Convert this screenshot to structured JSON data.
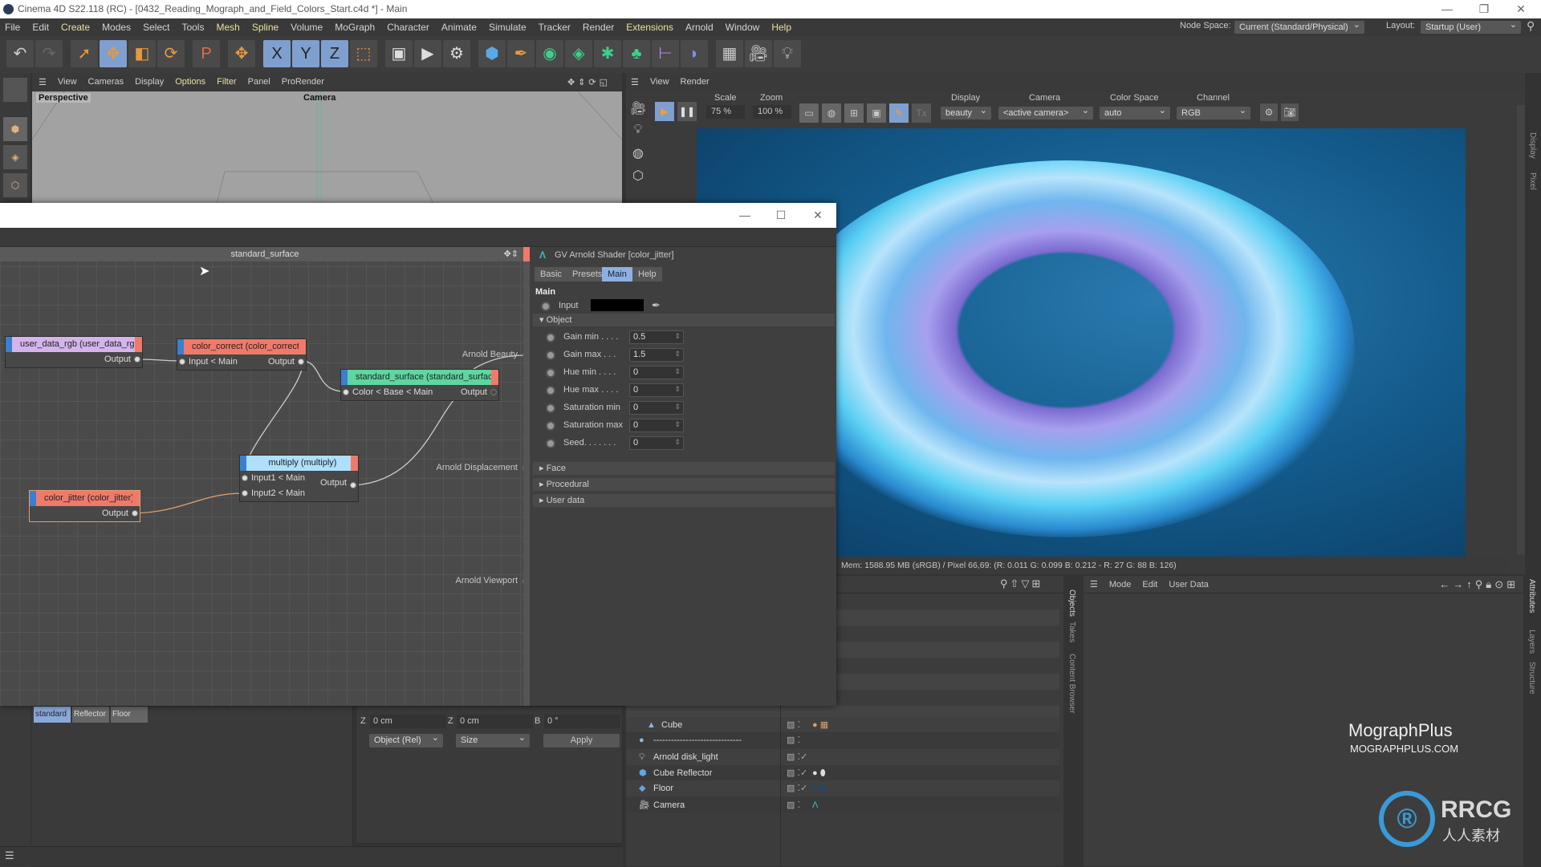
{
  "window": {
    "title": "Cinema 4D S22.118 (RC) - [0432_Reading_Mograph_and_Field_Colors_Start.c4d *] - Main"
  },
  "menu": [
    "File",
    "Edit",
    "Create",
    "Modes",
    "Select",
    "Tools",
    "Mesh",
    "Spline",
    "Volume",
    "MoGraph",
    "Character",
    "Animate",
    "Simulate",
    "Tracker",
    "Render",
    "Extensions",
    "Arnold",
    "Window",
    "Help"
  ],
  "menu_highlight": [
    "Create",
    "Mesh",
    "Spline",
    "Extensions",
    "Help"
  ],
  "topright": {
    "node_space_label": "Node Space:",
    "node_space_value": "Current (Standard/Physical)",
    "layout_label": "Layout:",
    "layout_value": "Startup (User)"
  },
  "toolbar_icons": [
    "undo-icon",
    "redo-icon",
    "select-icon",
    "move-icon",
    "scale-icon",
    "rotate-icon",
    "psr-icon",
    "axis-icon",
    "x-axis-icon",
    "y-axis-icon",
    "z-axis-icon",
    "coordinate-system-icon",
    "render-region-icon",
    "render-view-icon",
    "render-settings-icon",
    "cube-icon",
    "pen-icon",
    "subdivision-icon",
    "extrude-icon",
    "cloner-icon",
    "mograph-icon",
    "symmetry-icon",
    "deformer-icon",
    "floor-icon",
    "camera-icon",
    "light-icon"
  ],
  "viewport": {
    "menu": [
      "View",
      "Cameras",
      "Display",
      "Options",
      "Filter",
      "Panel",
      "ProRender"
    ],
    "label": "Perspective",
    "camera": "Camera"
  },
  "render_view": {
    "menu": [
      "View",
      "Render"
    ],
    "scale_label": "Scale",
    "scale_value": "75 %",
    "zoom_label": "Zoom",
    "zoom_value": "100 %",
    "display_label": "Display",
    "display_value": "beauty",
    "camera_label": "Camera",
    "camera_value": "<active camera>",
    "colorspace_label": "Color Space",
    "colorspace_value": "auto",
    "channel_label": "Channel",
    "channel_value": "RGB",
    "status": "Mem: 1588.95 MB  (sRGB) / Pixel 66,69: (R: 0.011 G: 0.099 B: 0.212 - R: 27 G: 88 B: 126)",
    "side_tabs": [
      "Display",
      "Pixel"
    ]
  },
  "node_editor": {
    "header": "standard_surface",
    "nodes": {
      "user_data_rgb": {
        "title": "user_data_rgb (user_data_rgb)",
        "color": "#d4b4ea",
        "ports": [
          "Output"
        ]
      },
      "color_correct": {
        "title": "color_correct (color_correct)",
        "color": "#f07a6a",
        "ports": [
          "Input < Main",
          "Output"
        ]
      },
      "standard_surface": {
        "title": "standard_surface (standard_surface)",
        "color": "#5ed6a0",
        "ports": [
          "Color < Base < Main",
          "Output"
        ]
      },
      "multiply": {
        "title": "multiply (multiply)",
        "color": "#aee0fb",
        "ports": [
          "Input1 < Main",
          "Input2 < Main",
          "Output"
        ]
      },
      "color_jitter": {
        "title": "color_jitter (color_jitter)",
        "color": "#f07a6a",
        "ports": [
          "Output"
        ]
      }
    },
    "outputs": [
      "Arnold Beauty",
      "Arnold Displacement",
      "Arnold Viewport"
    ]
  },
  "attributes_shader": {
    "title": "GV Arnold Shader [color_jitter]",
    "tabs": [
      "Basic",
      "Presets",
      "Main",
      "Help"
    ],
    "active_tab": "Main",
    "section": "Main",
    "input_label": "Input",
    "input_color": "#000000",
    "object_section": "Object",
    "fields": [
      {
        "label": "Gain min . . . .",
        "value": "0.5"
      },
      {
        "label": "Gain max  . . .",
        "value": "1.5"
      },
      {
        "label": "Hue min . . . .",
        "value": "0"
      },
      {
        "label": "Hue max . . . .",
        "value": "0"
      },
      {
        "label": "Saturation min",
        "value": "0"
      },
      {
        "label": "Saturation max",
        "value": "0"
      },
      {
        "label": "Seed. . . . . . .",
        "value": "0"
      }
    ],
    "collapsed_sections": [
      "Face",
      "Procedural",
      "User data"
    ]
  },
  "materials": [
    "standard",
    "Reflector",
    "Floor"
  ],
  "coordinates": {
    "z_label": "Z",
    "z_pos": "0 cm",
    "z_size_label": "Z",
    "z_size": "0 cm",
    "b_label": "B",
    "b_rot": "0 °",
    "mode": "Object (Rel)",
    "size_mode": "Size",
    "apply": "Apply"
  },
  "objects": {
    "rows": [
      {
        "name": "Cube"
      },
      {
        "name": "------------------------------"
      },
      {
        "name": "Arnold disk_light"
      },
      {
        "name": "Cube Reflector"
      },
      {
        "name": "Floor"
      },
      {
        "name": "Camera"
      }
    ],
    "side_tabs": [
      "Objects",
      "Takes",
      "Content Browser"
    ]
  },
  "attributes": {
    "menu": [
      "Mode",
      "Edit",
      "User Data"
    ],
    "side_tabs": [
      "Attributes",
      "Layers",
      "Structure"
    ]
  },
  "watermark": {
    "brand": "MographPlus",
    "url": "MOGRAPHPLUS.COM",
    "logo_text": "RRCG",
    "logo_sub": "人人素材"
  }
}
